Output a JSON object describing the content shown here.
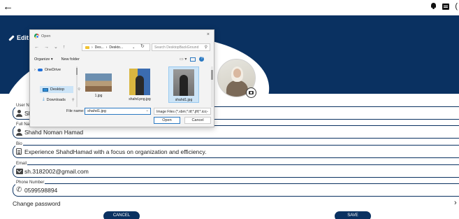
{
  "app": {
    "header_title": "Edit Profile",
    "icons": [
      "back-arrow-icon",
      "bell-icon",
      "chat-icon",
      "pencil-icon",
      "camera-icon"
    ],
    "edge_char": "("
  },
  "colors": {
    "brand": "#0a3161"
  },
  "fields": {
    "username": {
      "label": "User Nam",
      "value": "Sha"
    },
    "fullname": {
      "label": "Full Nam",
      "value": "Shahd Noman Hamad"
    },
    "bio": {
      "label": "Bio",
      "value": "Experience ShahdHamad with a focus on organization and efficiency."
    },
    "email": {
      "label": "Email",
      "value": "sh.3182002@gmail.com"
    },
    "phone": {
      "label": "Phone Number",
      "value": "0599598894"
    }
  },
  "change_password": "Change password",
  "buttons": {
    "cancel": "CANCEL",
    "save": "SAVE"
  },
  "dialog": {
    "title": "Open",
    "close": "×",
    "nav": {
      "back": "←",
      "forward": "→",
      "down": "⌄",
      "up": "↑"
    },
    "breadcrumb": [
      "Des...",
      "Deskto..."
    ],
    "search_placeholder": "Search DesktopBackGround",
    "toolbar": {
      "organize": "Organize ▾",
      "new_folder": "New folder"
    },
    "nav_pane": {
      "onedrive": "OneDrive",
      "desktop": "Desktop",
      "downloads": "Downloads"
    },
    "files": [
      {
        "name": "1.jpg",
        "selected": false
      },
      {
        "name": "shahd.png.jpg",
        "selected": false
      },
      {
        "name": "shahd1.jpg",
        "selected": true
      }
    ],
    "file_name_label": "File name:",
    "file_name_value": "shahd1.jpg",
    "file_type": "Image Files (*.xbm;*.tif;*.jfif;*.ico;",
    "open_button": "Open",
    "cancel_button": "Cancel"
  }
}
